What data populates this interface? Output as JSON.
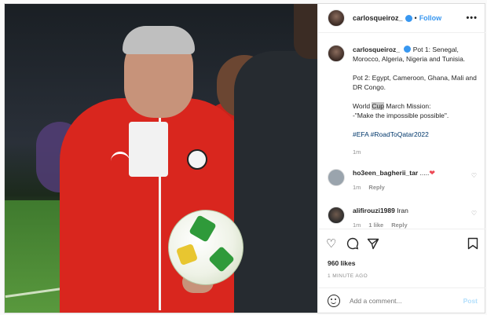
{
  "header": {
    "username": "carlosqueiroz_",
    "separator": "•",
    "follow_label": "Follow",
    "more_label": "•••"
  },
  "caption": {
    "username": "carlosqueiroz_",
    "line1": "Pot 1: Senegal, Morocco, Algeria, Nigeria and Tunisia.",
    "line2": "Pot 2: Egypt, Cameroon, Ghana, Mali and DR Congo.",
    "line3_pre": "World ",
    "line3_hl": "Cup",
    "line3_post": " March Mission:",
    "line4": "-\"Make the impossible possible\".",
    "hashtags": "#EFA #RoadToQatar2022",
    "time": "1m"
  },
  "comments": [
    {
      "username": "ho3een_bagherii_tar",
      "text": " .....",
      "heart": "❤",
      "time": "1m",
      "reply": "Reply"
    },
    {
      "username": "alifirouzi1989",
      "text": " Iran",
      "time": "1m",
      "likes": "1 like",
      "reply": "Reply"
    }
  ],
  "actions": {
    "likes": "960 likes",
    "time_ago": "1 MINUTE AGO",
    "comment_placeholder": "Add a comment...",
    "post_label": "Post"
  },
  "icons": [
    "heart-icon",
    "comment-icon",
    "share-icon",
    "bookmark-icon",
    "emoji-icon"
  ],
  "colors": {
    "accent": "#3897f0",
    "heart_red": "#ed4956",
    "text": "#262626",
    "muted": "#8e8e8e"
  }
}
